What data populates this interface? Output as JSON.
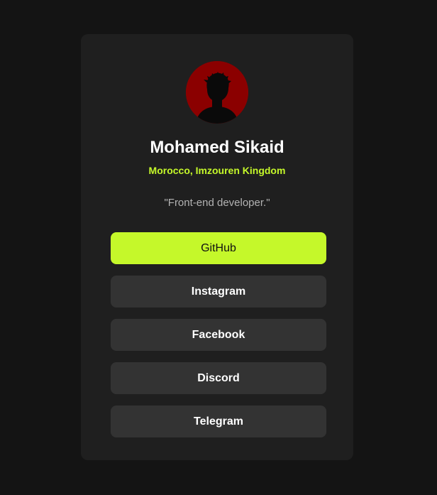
{
  "profile": {
    "name": "Mohamed Sikaid",
    "location": "Morocco, Imzouren Kingdom",
    "bio": "\"Front-end developer.\"",
    "avatar_icon": "person-silhouette-icon",
    "avatar_bg": "#8b0000"
  },
  "links": [
    {
      "label": "GitHub",
      "style": "primary"
    },
    {
      "label": "Instagram",
      "style": "default"
    },
    {
      "label": "Facebook",
      "style": "default"
    },
    {
      "label": "Discord",
      "style": "default"
    },
    {
      "label": "Telegram",
      "style": "default"
    }
  ],
  "colors": {
    "page_bg": "#141414",
    "card_bg": "#1f1f1f",
    "accent": "#c5f82a",
    "button_bg": "#333333",
    "text_primary": "#ffffff",
    "text_muted": "#b3b3b3"
  }
}
